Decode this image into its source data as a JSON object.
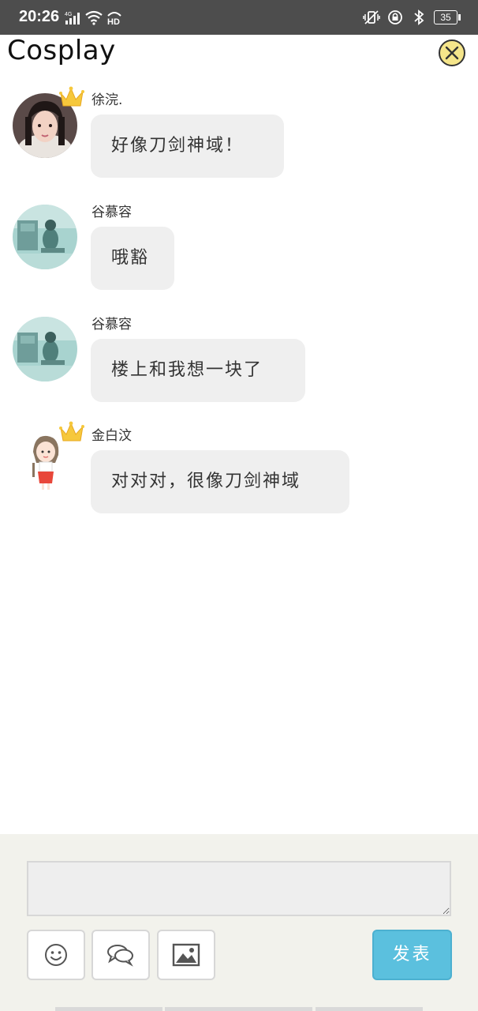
{
  "status_bar": {
    "time": "20:26",
    "battery": "35",
    "left_icons": [
      "signal-4g-icon",
      "wifi-icon",
      "hd-icon"
    ],
    "right_icons": [
      "vibrate-icon",
      "privacy-icon",
      "bluetooth-icon",
      "battery-icon"
    ]
  },
  "header": {
    "title": "Cosplay",
    "close_icon": "close-circle-icon",
    "close_color": "#f5e58a"
  },
  "messages": [
    {
      "sender": "徐浣.",
      "text": "好像刀剑神域！",
      "crown": true,
      "avatar": "photo-avatar"
    },
    {
      "sender": "谷慕容",
      "text": "哦豁",
      "crown": false,
      "avatar": "teal-photo-avatar"
    },
    {
      "sender": "谷慕容",
      "text": "楼上和我想一块了",
      "crown": false,
      "avatar": "teal-photo-avatar"
    },
    {
      "sender": "金白汶",
      "text": "对对对，很像刀剑神域",
      "crown": true,
      "avatar": "cartoon-girl-avatar"
    }
  ],
  "composer": {
    "input_value": "",
    "input_placeholder": "",
    "tools": [
      "emoji-icon",
      "chat-bubbles-icon",
      "image-icon"
    ],
    "send_label": "发表",
    "send_color": "#5bc0de"
  }
}
